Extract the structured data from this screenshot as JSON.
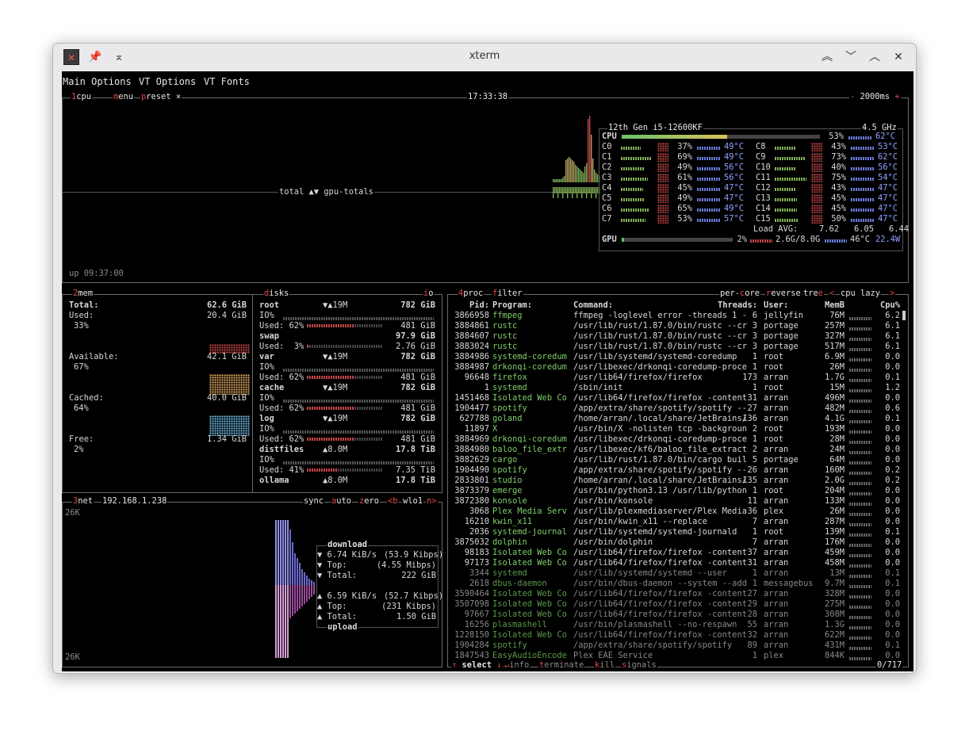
{
  "window": {
    "title": "xterm"
  },
  "menu": [
    "Main Options",
    "VT Options",
    "VT Fonts"
  ],
  "cpu_box": {
    "label_num": "1",
    "label": "cpu",
    "menu": "menu",
    "preset": "preset",
    "preset_x": "×",
    "clock": "17:33:38",
    "interval": "2000ms",
    "minus": "-",
    "plus": "+",
    "graph_label": "total ▲▼ gpu-totals",
    "uptime": "up 09:37:00",
    "model": "12th Gen i5-12600KF",
    "freq": "4.5 GHz",
    "cpu_total": {
      "name": "CPU",
      "pct": "53%",
      "temp": "62°C",
      "level": 0.53
    },
    "cores": [
      {
        "n": "C0",
        "p": "37%",
        "t": "49°C"
      },
      {
        "n": "C1",
        "p": "69%",
        "t": "49°C"
      },
      {
        "n": "C2",
        "p": "49%",
        "t": "56°C"
      },
      {
        "n": "C3",
        "p": "61%",
        "t": "56°C"
      },
      {
        "n": "C4",
        "p": "45%",
        "t": "47°C"
      },
      {
        "n": "C5",
        "p": "49%",
        "t": "47°C"
      },
      {
        "n": "C6",
        "p": "65%",
        "t": "49°C"
      },
      {
        "n": "C7",
        "p": "53%",
        "t": "57°C"
      },
      {
        "n": "C8",
        "p": "43%",
        "t": "53°C"
      },
      {
        "n": "C9",
        "p": "73%",
        "t": "62°C"
      },
      {
        "n": "C10",
        "p": "40%",
        "t": "56°C"
      },
      {
        "n": "C11",
        "p": "75%",
        "t": "54°C"
      },
      {
        "n": "C12",
        "p": "43%",
        "t": "47°C"
      },
      {
        "n": "C13",
        "p": "45%",
        "t": "47°C"
      },
      {
        "n": "C14",
        "p": "45%",
        "t": "47°C"
      },
      {
        "n": "C15",
        "p": "50%",
        "t": "47°C"
      }
    ],
    "load_label": "Load AVG:",
    "load": [
      "7.62",
      "6.05",
      "6.44"
    ],
    "gpu": {
      "name": "GPU",
      "pct": "2%",
      "mem": "2.6G/8.0G",
      "temp": "46°C",
      "power": "22.4W",
      "level": 0.02
    }
  },
  "mem_box": {
    "label_num": "2",
    "label": "mem",
    "total_label": "Total:",
    "total": "62.6 GiB",
    "used_label": "Used:",
    "used": "20.4 GiB",
    "used_pct": "33%",
    "avail_label": "Available:",
    "avail": "42.1 GiB",
    "avail_pct": "67%",
    "cached_label": "Cached:",
    "cached": "40.0 GiB",
    "cached_pct": "64%",
    "free_label": "Free:",
    "free": "1.34 GiB",
    "free_pct": "2%"
  },
  "disks_box": {
    "label": "disks",
    "io": "io",
    "rows": [
      {
        "name": "root",
        "io": "▼▲19M",
        "size": "782 GiB",
        "used": "Used: 62%",
        "used_size": "481 GiB",
        "level": 0.62
      },
      {
        "name": "swap",
        "io": "",
        "size": "97.9 GiB",
        "used": "Used:  3%",
        "used_size": "2.76 GiB",
        "level": 0.03
      },
      {
        "name": "var",
        "io": "▼▲19M",
        "size": "782 GiB",
        "used": "Used: 62%",
        "used_size": "481 GiB",
        "level": 0.62
      },
      {
        "name": "cache",
        "io": "▼▲19M",
        "size": "782 GiB",
        "used": "Used: 62%",
        "used_size": "481 GiB",
        "level": 0.62
      },
      {
        "name": "log",
        "io": "▼▲19M",
        "size": "782 GiB",
        "used": "Used: 62%",
        "used_size": "481 GiB",
        "level": 0.62
      },
      {
        "name": "distfiles",
        "io": "▲8.0M",
        "size": "17.8 TiB",
        "used": "Used: 41%",
        "used_size": "7.35 TiB",
        "level": 0.41
      },
      {
        "name": "ollama",
        "io": "▲8.0M",
        "size": "17.8 TiB",
        "used": "",
        "used_size": "",
        "level": 0
      }
    ],
    "io_label": "IO%"
  },
  "net_box": {
    "label_num": "3",
    "label": "net",
    "ip": "192.168.1.238",
    "sync": "sync",
    "auto": "auto",
    "zero": "zero",
    "iface_prev": "<b",
    "iface": "wlo1",
    "iface_next": "n>",
    "scale_top": "26K",
    "scale_bottom": "26K",
    "download_title": "download",
    "upload_title": "upload",
    "down_rate": "6.74 KiB/s",
    "down_rate_b": "(53.9 Kibps)",
    "down_top_label": "Top:",
    "down_top": "(4.55 Mibps)",
    "down_total_label": "Total:",
    "down_total": "222 GiB",
    "up_rate": "6.59 KiB/s",
    "up_rate_b": "(52.7 Kibps)",
    "up_top_label": "Top:",
    "up_top": "(231 Kibps)",
    "up_total_label": "Total:",
    "up_total": "1.50 GiB"
  },
  "proc_box": {
    "label_num": "4",
    "label": "proc",
    "filter": "filter",
    "per_core": "per-core",
    "reverse": "reverse",
    "tree": "tree",
    "sort_prev": "<",
    "sort": "cpu lazy",
    "sort_next": ">",
    "headers": {
      "pid": "Pid:",
      "program": "Program:",
      "command": "Command:",
      "threads": "Threads:",
      "user": "User:",
      "memb": "MemB",
      "cpu": "Cpu%"
    },
    "rows": [
      {
        "pid": "3866958",
        "prog": "ffmpeg",
        "cmd": "ffmpeg -loglevel error -threads 1 -",
        "th": "6",
        "user": "jellyfin",
        "mem": "76M",
        "cpu": "6.2"
      },
      {
        "pid": "3884861",
        "prog": "rustc",
        "cmd": "/usr/lib/rust/1.87.0/bin/rustc --cr",
        "th": "3",
        "user": "portage",
        "mem": "257M",
        "cpu": "6.1"
      },
      {
        "pid": "3884607",
        "prog": "rustc",
        "cmd": "/usr/lib/rust/1.87.0/bin/rustc --cr",
        "th": "3",
        "user": "portage",
        "mem": "327M",
        "cpu": "6.1"
      },
      {
        "pid": "3883024",
        "prog": "rustc",
        "cmd": "/usr/lib/rust/1.87.0/bin/rustc --cr",
        "th": "3",
        "user": "portage",
        "mem": "517M",
        "cpu": "6.1"
      },
      {
        "pid": "3884986",
        "prog": "systemd-coredum",
        "cmd": "/usr/lib/systemd/systemd-coredump",
        "th": "1",
        "user": "root",
        "mem": "6.9M",
        "cpu": "0.0"
      },
      {
        "pid": "3884987",
        "prog": "drkonqi-coredum",
        "cmd": "/usr/libexec/drkonqi-coredump-proce",
        "th": "1",
        "user": "root",
        "mem": "26M",
        "cpu": "0.0"
      },
      {
        "pid": "96648",
        "prog": "firefox",
        "cmd": "/usr/lib64/firefox/firefox",
        "th": "173",
        "user": "arran",
        "mem": "1.7G",
        "cpu": "0.1"
      },
      {
        "pid": "1",
        "prog": "systemd",
        "cmd": "/sbin/init",
        "th": "1",
        "user": "root",
        "mem": "15M",
        "cpu": "1.2"
      },
      {
        "pid": "1451468",
        "prog": "Isolated Web Co",
        "cmd": "/usr/lib64/firefox/firefox -content",
        "th": "31",
        "user": "arran",
        "mem": "496M",
        "cpu": "0.0"
      },
      {
        "pid": "1904477",
        "prog": "spotify",
        "cmd": "/app/extra/share/spotify/spotify --",
        "th": "27",
        "user": "arran",
        "mem": "482M",
        "cpu": "0.6"
      },
      {
        "pid": "627788",
        "prog": "goland",
        "cmd": "/home/arran/.local/share/JetBrains/",
        "th": "136",
        "user": "arran",
        "mem": "4.1G",
        "cpu": "0.1"
      },
      {
        "pid": "11897",
        "prog": "X",
        "cmd": "/usr/bin/X -nolisten tcp -backgroun",
        "th": "2",
        "user": "root",
        "mem": "193M",
        "cpu": "0.0"
      },
      {
        "pid": "3884969",
        "prog": "drkonqi-coredum",
        "cmd": "/usr/libexec/drkonqi-coredump-proce",
        "th": "1",
        "user": "root",
        "mem": "28M",
        "cpu": "0.0"
      },
      {
        "pid": "3884980",
        "prog": "baloo_file_extr",
        "cmd": "/usr/libexec/kf6/baloo_file_extract",
        "th": "2",
        "user": "arran",
        "mem": "24M",
        "cpu": "0.0"
      },
      {
        "pid": "3882629",
        "prog": "cargo",
        "cmd": "/usr/lib/rust/1.87.0/bin/cargo buil",
        "th": "5",
        "user": "portage",
        "mem": "64M",
        "cpu": "0.0"
      },
      {
        "pid": "1904490",
        "prog": "spotify",
        "cmd": "/app/extra/share/spotify/spotify --",
        "th": "26",
        "user": "arran",
        "mem": "160M",
        "cpu": "0.2"
      },
      {
        "pid": "2833801",
        "prog": "studio",
        "cmd": "/home/arran/.local/share/JetBrains/",
        "th": "135",
        "user": "arran",
        "mem": "2.0G",
        "cpu": "0.2"
      },
      {
        "pid": "3873379",
        "prog": "emerge",
        "cmd": "/usr/bin/python3.13 /usr/lib/python",
        "th": "1",
        "user": "root",
        "mem": "204M",
        "cpu": "0.0"
      },
      {
        "pid": "3872380",
        "prog": "konsole",
        "cmd": "/usr/bin/konsole",
        "th": "11",
        "user": "arran",
        "mem": "133M",
        "cpu": "0.0"
      },
      {
        "pid": "3068",
        "prog": "Plex Media Serv",
        "cmd": "/usr/lib/plexmediaserver/Plex Media",
        "th": "36",
        "user": "plex",
        "mem": "26M",
        "cpu": "0.0"
      },
      {
        "pid": "16210",
        "prog": "kwin_x11",
        "cmd": "/usr/bin/kwin_x11 --replace",
        "th": "7",
        "user": "arran",
        "mem": "287M",
        "cpu": "0.0"
      },
      {
        "pid": "2036",
        "prog": "systemd-journal",
        "cmd": "/usr/lib/systemd/systemd-journald",
        "th": "1",
        "user": "root",
        "mem": "139M",
        "cpu": "0.1"
      },
      {
        "pid": "3875032",
        "prog": "dolphin",
        "cmd": "/usr/bin/dolphin",
        "th": "7",
        "user": "arran",
        "mem": "176M",
        "cpu": "0.0"
      },
      {
        "pid": "98183",
        "prog": "Isolated Web Co",
        "cmd": "/usr/lib64/firefox/firefox -content",
        "th": "37",
        "user": "arran",
        "mem": "459M",
        "cpu": "0.0"
      },
      {
        "pid": "97173",
        "prog": "Isolated Web Co",
        "cmd": "/usr/lib64/firefox/firefox -content",
        "th": "31",
        "user": "arran",
        "mem": "458M",
        "cpu": "0.0"
      },
      {
        "pid": "3344",
        "prog": "systemd",
        "cmd": "/usr/lib/systemd/systemd --user",
        "th": "1",
        "user": "arran",
        "mem": "13M",
        "cpu": "0.1"
      },
      {
        "pid": "2618",
        "prog": "dbus-daemon",
        "cmd": "/usr/bin/dbus-daemon --system --add",
        "th": "1",
        "user": "messagebus",
        "mem": "9.7M",
        "cpu": "0.1"
      },
      {
        "pid": "3590464",
        "prog": "Isolated Web Co",
        "cmd": "/usr/lib64/firefox/firefox -content",
        "th": "27",
        "user": "arran",
        "mem": "328M",
        "cpu": "0.0"
      },
      {
        "pid": "3507098",
        "prog": "Isolated Web Co",
        "cmd": "/usr/lib64/firefox/firefox -content",
        "th": "29",
        "user": "arran",
        "mem": "275M",
        "cpu": "0.0"
      },
      {
        "pid": "97667",
        "prog": "Isolated Web Co",
        "cmd": "/usr/lib64/firefox/firefox -content",
        "th": "28",
        "user": "arran",
        "mem": "308M",
        "cpu": "0.0"
      },
      {
        "pid": "16256",
        "prog": "plasmashell",
        "cmd": "/usr/bin/plasmashell --no-respawn",
        "th": "55",
        "user": "arran",
        "mem": "1.3G",
        "cpu": "0.0"
      },
      {
        "pid": "1228150",
        "prog": "Isolated Web Co",
        "cmd": "/usr/lib64/firefox/firefox -content",
        "th": "32",
        "user": "arran",
        "mem": "622M",
        "cpu": "0.0"
      },
      {
        "pid": "1904284",
        "prog": "spotify",
        "cmd": "/app/extra/share/spotify/spotify",
        "th": "89",
        "user": "arran",
        "mem": "431M",
        "cpu": "0.1"
      },
      {
        "pid": "1847543",
        "prog": "EasyAudioEncode",
        "cmd": "Plex EAE Service",
        "th": "1",
        "user": "plex",
        "mem": "844K",
        "cpu": "0.0"
      }
    ],
    "footer": {
      "select": "select",
      "info": "info",
      "terminate": "terminate",
      "kill": "kill",
      "signals": "signals",
      "count": "0/717"
    }
  },
  "colors": {
    "bg": "#000000",
    "border": "#6b6b6b",
    "accent_red": "#e04a4a",
    "proc_name": "#7fcf6a",
    "temp": "#8fa0ff"
  }
}
